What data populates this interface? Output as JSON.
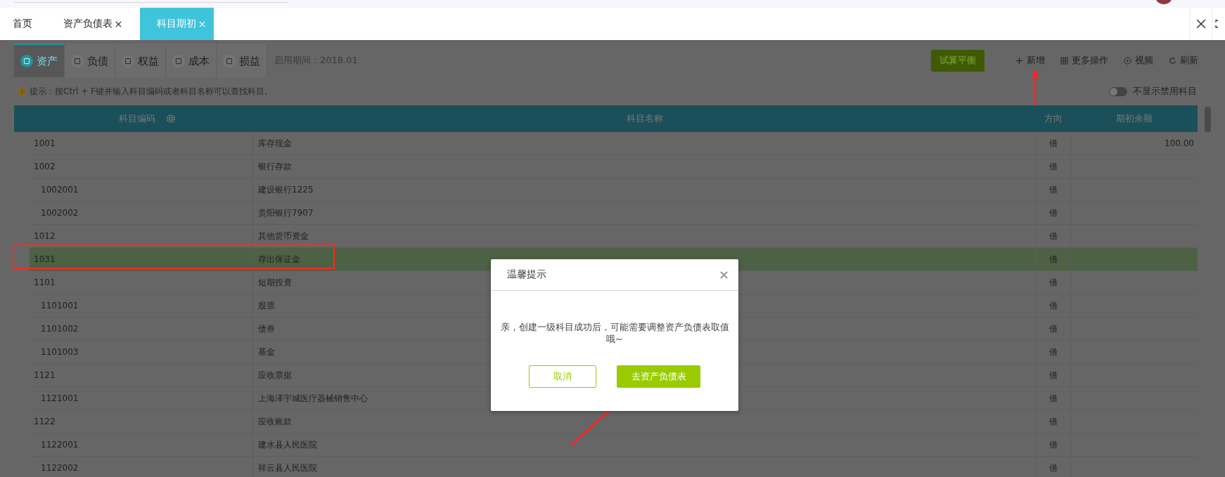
{
  "tabs": [
    {
      "label": "首页",
      "closable": false,
      "selected": false
    },
    {
      "label": "资产负债表",
      "closable": true,
      "selected": false
    },
    {
      "label": "科目期初",
      "closable": true,
      "selected": true
    }
  ],
  "category_tabs": [
    {
      "label": "资产",
      "selected": true
    },
    {
      "label": "负债",
      "selected": false
    },
    {
      "label": "权益",
      "selected": false
    },
    {
      "label": "成本",
      "selected": false
    },
    {
      "label": "损益",
      "selected": false
    }
  ],
  "period": "启用期间：2018.01",
  "toolbar": {
    "primary_button": "试算平衡",
    "actions": [
      {
        "kind": "add",
        "label": "新增"
      },
      {
        "kind": "more",
        "label": "更多操作"
      },
      {
        "kind": "video",
        "label": "视频"
      },
      {
        "kind": "refresh",
        "label": "刷新"
      }
    ]
  },
  "hint": "提示：按Ctrl + F键并输入科目编码或者科目名称可以查找科目。",
  "toggle": {
    "label": "不显示禁用科目",
    "on": false
  },
  "table": {
    "columns": [
      "科目编码",
      "科目名称",
      "方向",
      "期初余额"
    ],
    "rows": [
      {
        "code": "1001",
        "name": "库存现金",
        "direction": "借",
        "balance": "100.00",
        "selected": false
      },
      {
        "code": "1002",
        "name": "银行存款",
        "direction": "借",
        "selected": false,
        "children": [
          {
            "code": "1002001",
            "name": "建设银行1225",
            "direction": "借",
            "selected": false
          },
          {
            "code": "1002002",
            "name": "贵阳银行7907",
            "direction": "借",
            "selected": false
          }
        ]
      },
      {
        "code": "1012",
        "name": "其他货币资金",
        "direction": "借",
        "selected": false
      },
      {
        "code": "1031",
        "name": "存出保证金",
        "direction": "借",
        "selected": true
      },
      {
        "code": "1101",
        "name": "短期投资",
        "direction": "借",
        "selected": false,
        "children": [
          {
            "code": "1101001",
            "name": "股票",
            "direction": "借",
            "selected": false
          },
          {
            "code": "1101002",
            "name": "债券",
            "direction": "借",
            "selected": false
          },
          {
            "code": "1101003",
            "name": "基金",
            "direction": "借",
            "selected": false
          }
        ]
      },
      {
        "code": "1121",
        "name": "应收票据",
        "direction": "借",
        "selected": false,
        "children": [
          {
            "code": "1121001",
            "name": "上海泽宇城医疗器械销售中心",
            "direction": "借",
            "selected": false
          }
        ]
      },
      {
        "code": "1122",
        "name": "应收账款",
        "direction": "借",
        "selected": false,
        "children": [
          {
            "code": "1122001",
            "name": "建水县人民医院",
            "direction": "借",
            "selected": false
          },
          {
            "code": "1122002",
            "name": "祥云县人民医院",
            "direction": "借",
            "selected": false
          }
        ]
      }
    ]
  },
  "dialog": {
    "title": "温馨提示",
    "message": "亲，创建一级科目成功后，可能需要调整资产负债表取值哦~",
    "buttons": [
      {
        "kind": "secondary",
        "label": "取消"
      },
      {
        "kind": "primary",
        "label": "去资产负债表"
      }
    ]
  }
}
